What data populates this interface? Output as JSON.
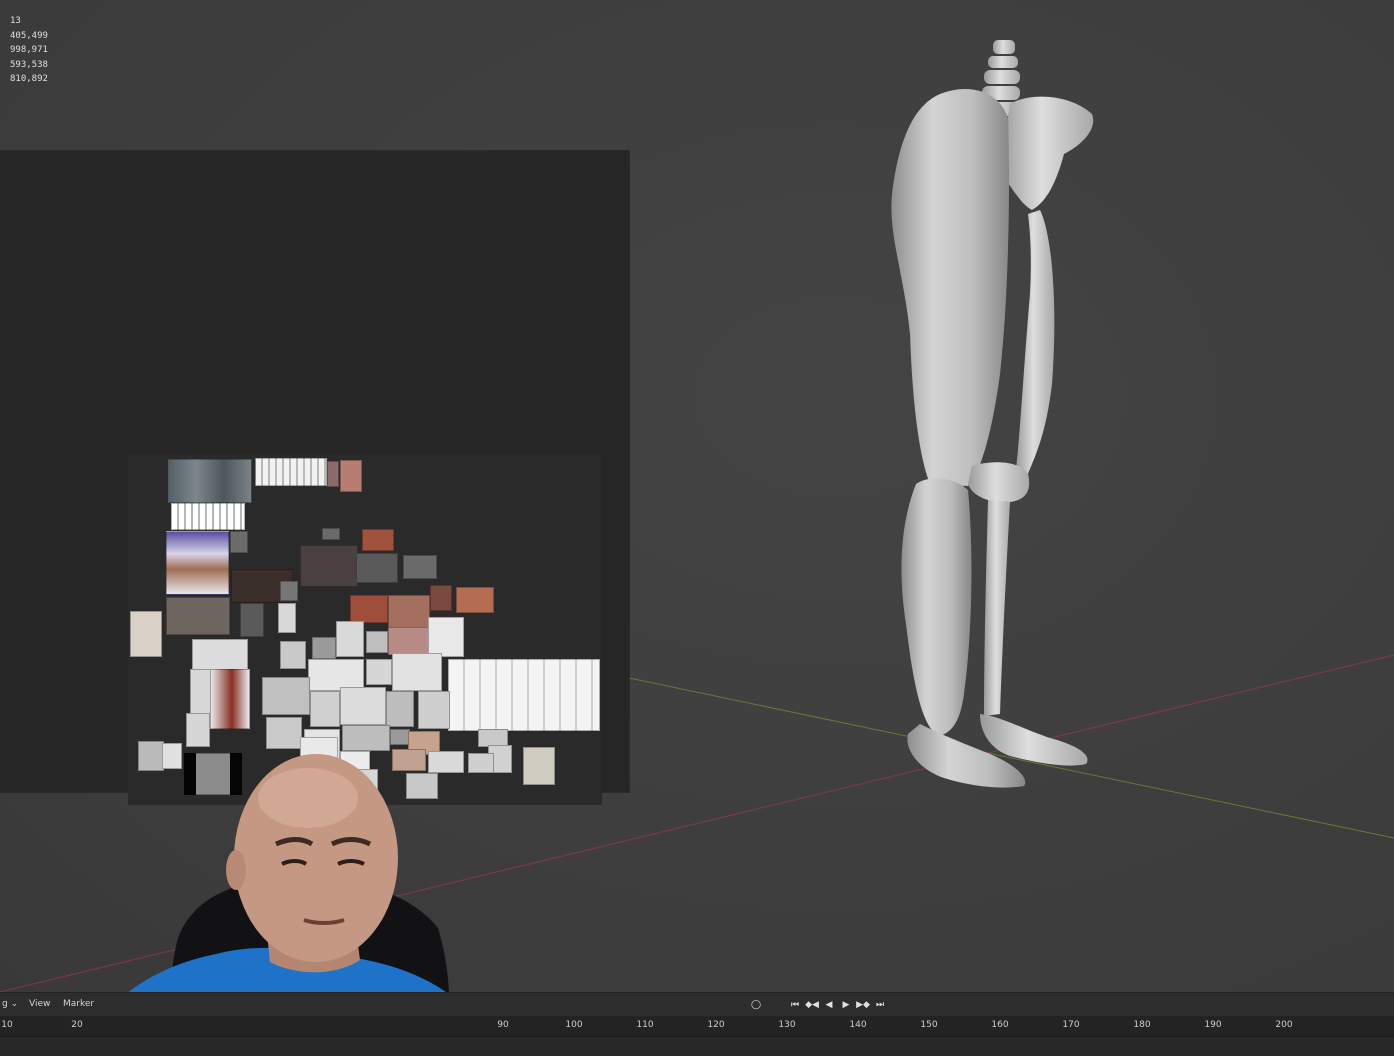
{
  "viewport": {
    "statistics": [
      "13",
      "405,499",
      "998,971",
      "593,538",
      "810,892"
    ]
  },
  "timeline": {
    "menus": [
      "View",
      "Marker"
    ],
    "controls": [
      "jump-start-icon",
      "prev-keyframe-icon",
      "play-reverse-icon",
      "play-icon",
      "next-keyframe-icon",
      "jump-end-icon"
    ],
    "ruler_ticks": [
      "10",
      "20",
      "90",
      "100",
      "110",
      "120",
      "130",
      "140",
      "150",
      "160",
      "170",
      "180",
      "190",
      "200"
    ]
  },
  "colors": {
    "viewport_bg": "#3e3e3e",
    "reference_bg": "#262627",
    "x_axis": "#9a3a44",
    "y_axis": "#7e8a2e",
    "header_bg": "#2d2d2d",
    "shirt": "#1e73c8"
  }
}
